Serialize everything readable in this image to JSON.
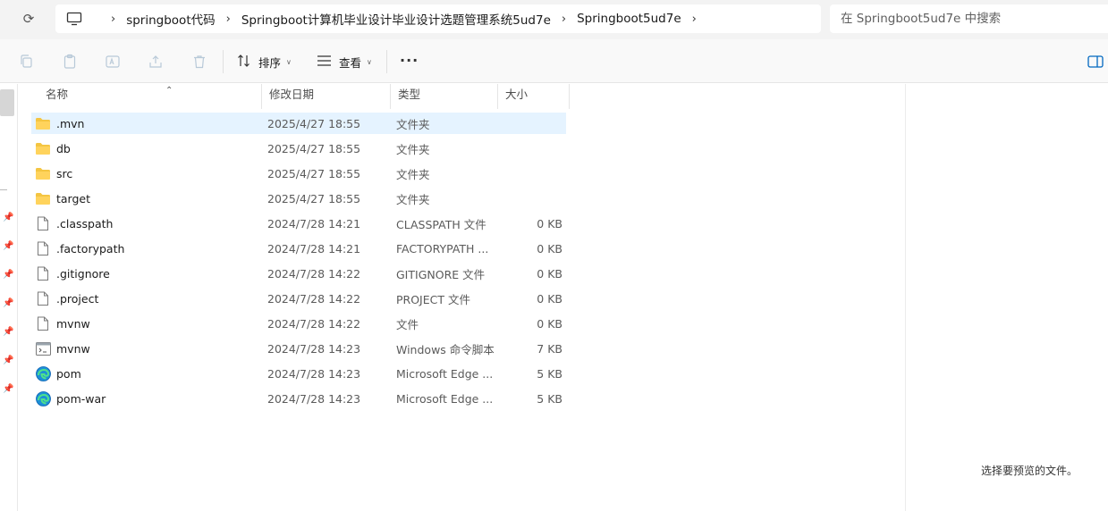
{
  "address": {
    "refresh_icon": "refresh-icon",
    "computer_icon": "computer-icon",
    "breadcrumbs": [
      "springboot代码",
      "Springboot计算机毕业设计毕业设计选题管理系统5ud7e",
      "Springboot5ud7e"
    ],
    "search_placeholder": "在 Springboot5ud7e 中搜索"
  },
  "toolbar": {
    "sort_label": "排序",
    "view_label": "查看",
    "more_label": "···"
  },
  "columns": {
    "name": "名称",
    "date": "修改日期",
    "type": "类型",
    "size": "大小"
  },
  "files": [
    {
      "name": ".mvn",
      "date": "2025/4/27 18:55",
      "type": "文件夹",
      "size": "",
      "icon": "folder-icon",
      "selected": true
    },
    {
      "name": "db",
      "date": "2025/4/27 18:55",
      "type": "文件夹",
      "size": "",
      "icon": "folder-icon"
    },
    {
      "name": "src",
      "date": "2025/4/27 18:55",
      "type": "文件夹",
      "size": "",
      "icon": "folder-icon"
    },
    {
      "name": "target",
      "date": "2025/4/27 18:55",
      "type": "文件夹",
      "size": "",
      "icon": "folder-icon"
    },
    {
      "name": ".classpath",
      "date": "2024/7/28 14:21",
      "type": "CLASSPATH 文件",
      "size": "0 KB",
      "icon": "file-icon"
    },
    {
      "name": ".factorypath",
      "date": "2024/7/28 14:21",
      "type": "FACTORYPATH ...",
      "size": "0 KB",
      "icon": "file-icon"
    },
    {
      "name": ".gitignore",
      "date": "2024/7/28 14:22",
      "type": "GITIGNORE 文件",
      "size": "0 KB",
      "icon": "file-icon"
    },
    {
      "name": ".project",
      "date": "2024/7/28 14:22",
      "type": "PROJECT 文件",
      "size": "0 KB",
      "icon": "file-icon"
    },
    {
      "name": "mvnw",
      "date": "2024/7/28 14:22",
      "type": "文件",
      "size": "0 KB",
      "icon": "file-icon"
    },
    {
      "name": "mvnw",
      "date": "2024/7/28 14:23",
      "type": "Windows 命令脚本",
      "size": "7 KB",
      "icon": "script-icon"
    },
    {
      "name": "pom",
      "date": "2024/7/28 14:23",
      "type": "Microsoft Edge ...",
      "size": "5 KB",
      "icon": "edge-icon"
    },
    {
      "name": "pom-war",
      "date": "2024/7/28 14:23",
      "type": "Microsoft Edge ...",
      "size": "5 KB",
      "icon": "edge-icon"
    }
  ],
  "preview": {
    "empty_text": "选择要预览的文件。"
  },
  "colors": {
    "selection": "#e5f3ff",
    "folder": "#f4c542",
    "accent": "#0067c0"
  }
}
